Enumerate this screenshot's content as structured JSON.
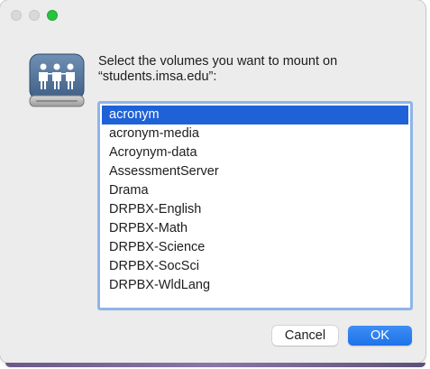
{
  "dialog": {
    "prompt_line1": "Select the volumes you want to mount on",
    "prompt_line2": "“students.imsa.edu”:",
    "icon": "server-people-icon",
    "volumes": [
      "acronym",
      "acronym-media",
      "Acroynym-data",
      "AssessmentServer",
      "Drama",
      "DRPBX-English",
      "DRPBX-Math",
      "DRPBX-Science",
      "DRPBX-SocSci",
      "DRPBX-WldLang"
    ],
    "selected_volume": "acronym",
    "cancel_label": "Cancel",
    "ok_label": "OK"
  },
  "colors": {
    "selection": "#1f62d8",
    "ok_button": "#2a7ff0",
    "list_focus_ring": "#8fb4e8",
    "zoom_light": "#29c240"
  }
}
